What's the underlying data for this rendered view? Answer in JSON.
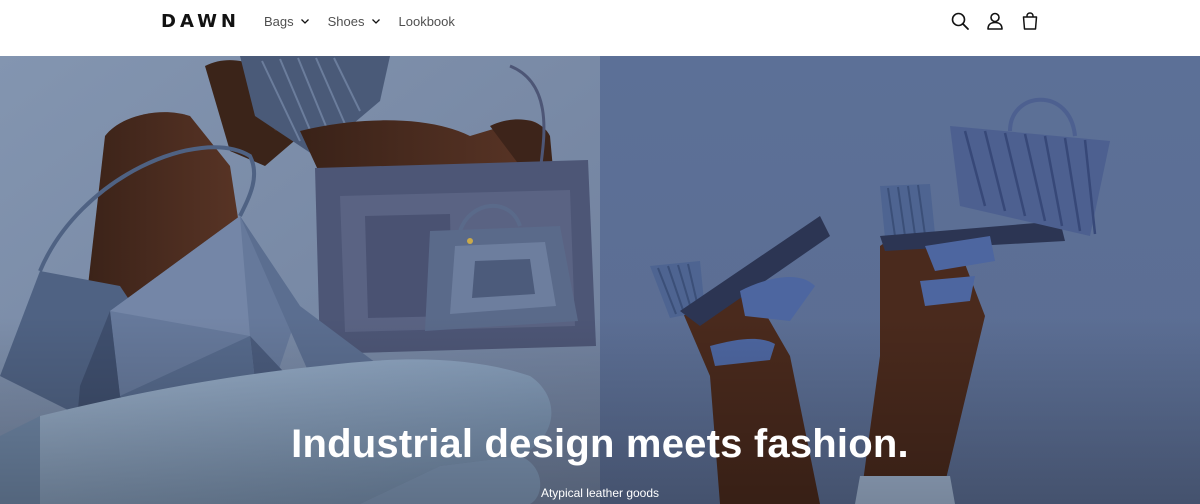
{
  "header": {
    "logo": "DAWN",
    "nav": [
      {
        "label": "Bags",
        "has_dropdown": true
      },
      {
        "label": "Shoes",
        "has_dropdown": true
      },
      {
        "label": "Lookbook",
        "has_dropdown": false
      }
    ],
    "icons": [
      "search-icon",
      "account-icon",
      "cart-icon"
    ]
  },
  "hero": {
    "title": "Industrial design meets fashion.",
    "subtitle": "Atypical leather goods"
  },
  "colors": {
    "header_bg": "#ffffff",
    "hero_bg_left": "#7a8aa6",
    "hero_bg_right": "#566b93",
    "text_dark": "#121212",
    "text_light": "#ffffff"
  }
}
